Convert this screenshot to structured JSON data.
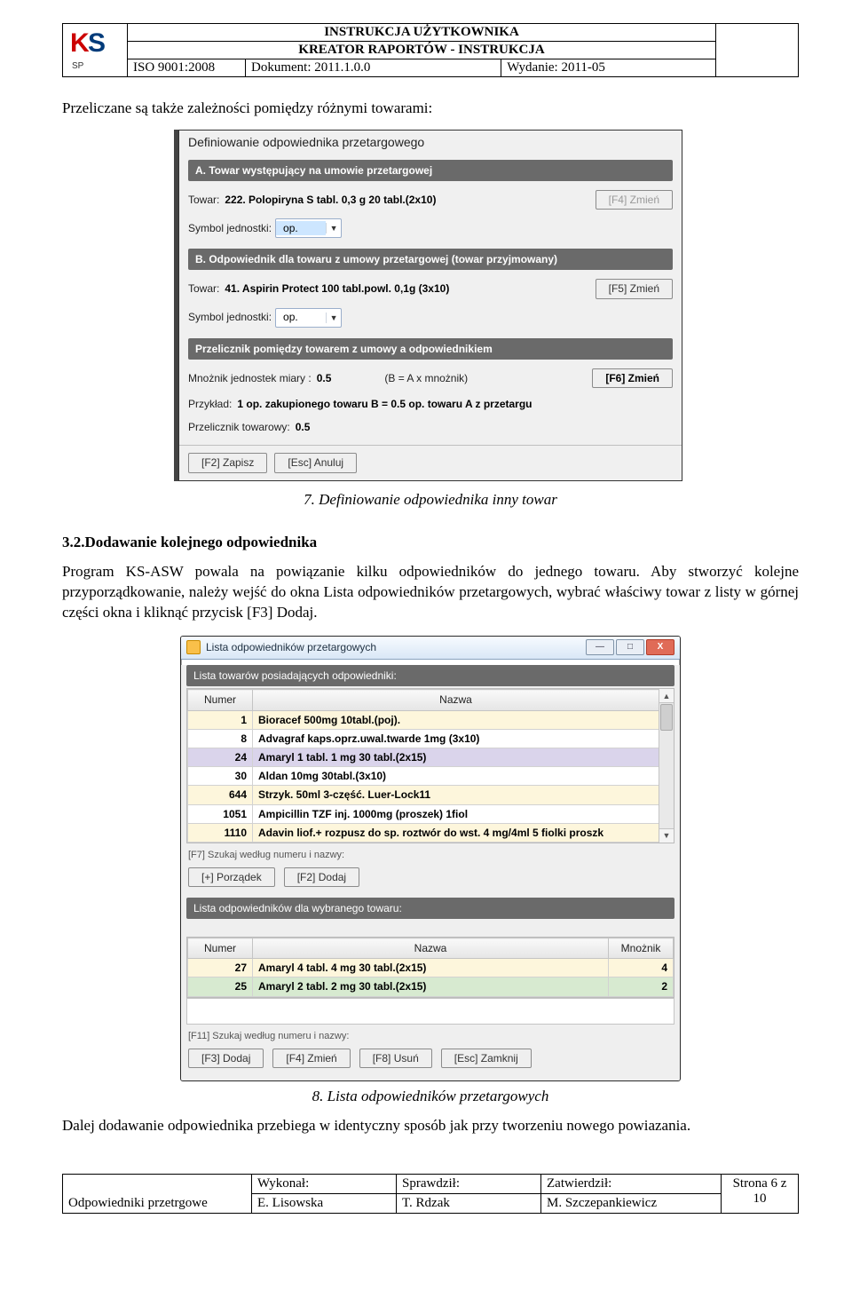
{
  "header": {
    "title": "INSTRUKCJA UŻYTKOWNIKA",
    "subtitle": "KREATOR RAPORTÓW - INSTRUKCJA",
    "iso": "ISO 9001:2008",
    "doc": "Dokument: 2011.1.0.0",
    "issue": "Wydanie: 2011-05"
  },
  "sentence_intro": "Przeliczane są także zależności pomiędzy różnymi towarami:",
  "dlg1": {
    "title": "Definiowanie odpowiednika przetargowego",
    "sectA": "A. Towar występujący na umowie przetargowej",
    "a_towar_lbl": "Towar:",
    "a_towar_val": "222. Polopiryna S tabl. 0,3 g 20 tabl.(2x10)",
    "a_btn": "[F4] Zmień",
    "a_sym_lbl": "Symbol jednostki:",
    "a_sym_val": "op.",
    "sectB": "B. Odpowiednik dla towaru z umowy przetargowej (towar przyjmowany)",
    "b_towar_lbl": "Towar:",
    "b_towar_val": "41. Aspirin Protect 100 tabl.powl. 0,1g (3x10)",
    "b_btn": "[F5] Zmień",
    "b_sym_lbl": "Symbol jednostki:",
    "b_sym_val": "op.",
    "sectC": "Przelicznik pomiędzy towarem z umowy a odpowiednikiem",
    "mn_lbl": "Mnożnik jednostek miary :",
    "mn_val": "0.5",
    "mn_formula": "(B = A x mnożnik)",
    "c_btn": "[F6] Zmień",
    "ex_lbl": "Przykład:",
    "ex_val": "1 op. zakupionego towaru B   =   0.5 op. towaru A z przetargu",
    "pt_lbl": "Przelicznik towarowy:",
    "pt_val": "0.5",
    "btn_save": "[F2] Zapisz",
    "btn_cancel": "[Esc] Anuluj"
  },
  "caption7": "7.   Definiowanie odpowiednika inny towar",
  "heading32": "3.2.Dodawanie kolejnego odpowiednika",
  "para32": "Program KS-ASW powala na powiązanie kilku odpowiedników do jednego towaru. Aby stworzyć kolejne przyporządkowanie, należy wejść do okna Lista odpowiedników przetargowych, wybrać właściwy towar z listy w górnej części okna i kliknąć przycisk [F3] Dodaj.",
  "dlg2": {
    "title": "Lista odpowiedników przetargowych",
    "bar1": "Lista towarów posiadających odpowiedniki:",
    "th_num": "Numer",
    "th_name": "Nazwa",
    "rows1": [
      {
        "n": "1",
        "name": "Bioracef 500mg 10tabl.(poj)."
      },
      {
        "n": "8",
        "name": "Advagraf kaps.oprz.uwal.twarde 1mg (3x10)"
      },
      {
        "n": "24",
        "name": "Amaryl 1 tabl. 1 mg 30 tabl.(2x15)"
      },
      {
        "n": "30",
        "name": "Aldan 10mg 30tabl.(3x10)"
      },
      {
        "n": "644",
        "name": "Strzyk. 50ml 3-część. Luer-Lock11"
      },
      {
        "n": "1051",
        "name": "Ampicillin TZF inj. 1000mg (proszek) 1fiol"
      },
      {
        "n": "1110",
        "name": "Adavin liof.+ rozpusz do sp. roztwór do wst. 4 mg/4ml 5 fiolki proszk"
      }
    ],
    "hint1": "[F7] Szukaj według numeru i nazwy:",
    "btn_order": "[+] Porządek",
    "btn_add1": "[F2] Dodaj",
    "bar2": "Lista odpowiedników dla wybranego towaru:",
    "th_mn": "Mnożnik",
    "rows2": [
      {
        "n": "27",
        "name": "Amaryl 4 tabl. 4 mg 30 tabl.(2x15)",
        "m": "4"
      },
      {
        "n": "25",
        "name": "Amaryl 2 tabl. 2 mg 30 tabl.(2x15)",
        "m": "2"
      }
    ],
    "hint2": "[F11] Szukaj według numeru i nazwy:",
    "btn_add2": "[F3] Dodaj",
    "btn_edit2": "[F4] Zmień",
    "btn_del2": "[F8] Usuń",
    "btn_close2": "[Esc] Zamknij"
  },
  "caption8": "8.   Lista odpowiedników przetargowych",
  "para_after": "Dalej dodawanie odpowiednika przebiega w identyczny sposób jak przy tworzeniu nowego powiazania.",
  "footer": {
    "c1a": "Odpowiedniki przetrgowe",
    "c2a": "Wykonał:",
    "c2b": "E. Lisowska",
    "c3a": "Sprawdził:",
    "c3b": "T. Rdzak",
    "c4a": "Zatwierdził:",
    "c4b": "M. Szczepankiewicz",
    "c5": "Strona 6 z 10"
  }
}
